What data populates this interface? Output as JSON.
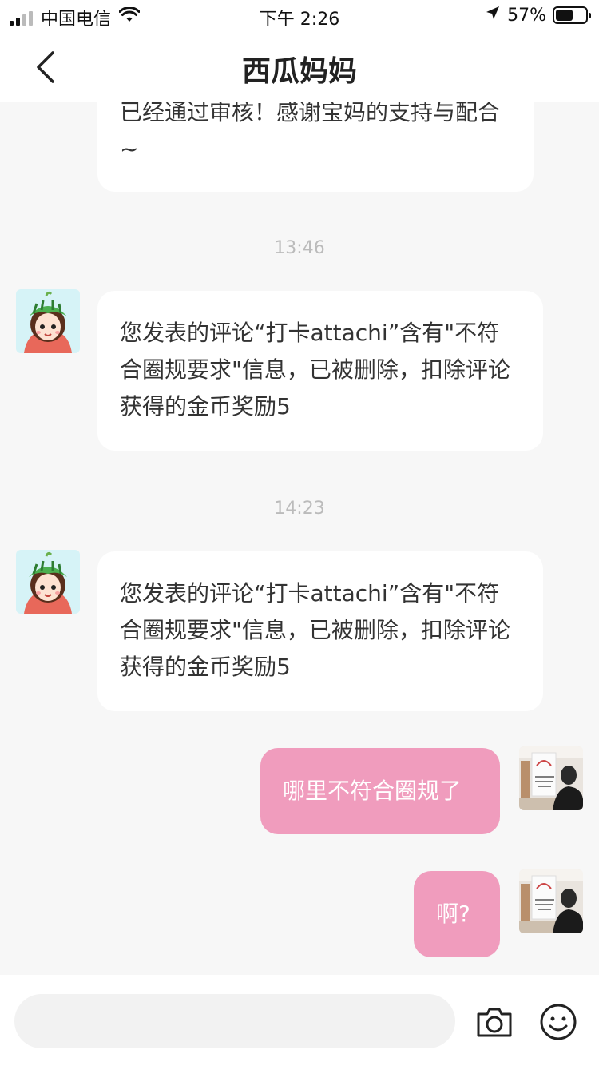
{
  "status_bar": {
    "carrier": "中国电信",
    "time": "下午 2:26",
    "battery": "57%",
    "battery_level": 0.57
  },
  "nav": {
    "title": "西瓜妈妈"
  },
  "messages": [
    {
      "text": "已经通过审核！感谢宝妈的支持与配合~"
    },
    {
      "time": "13:46",
      "text": "您发表的评论“打卡attachi”含有\"不符合圈规要求\"信息，已被删除，扣除评论获得的金币奖励5"
    },
    {
      "time": "14:23",
      "text": "您发表的评论“打卡attachi”含有\"不符合圈规要求\"信息，已被删除，扣除评论获得的金币奖励5"
    },
    {
      "text": "哪里不符合圈规了"
    },
    {
      "text": "啊?"
    }
  ],
  "input": {
    "placeholder": ""
  },
  "icons": {
    "back": "chevron-left-icon",
    "camera": "camera-icon",
    "emoji": "emoji-icon"
  },
  "colors": {
    "accent_pink": "#f09cbd"
  }
}
